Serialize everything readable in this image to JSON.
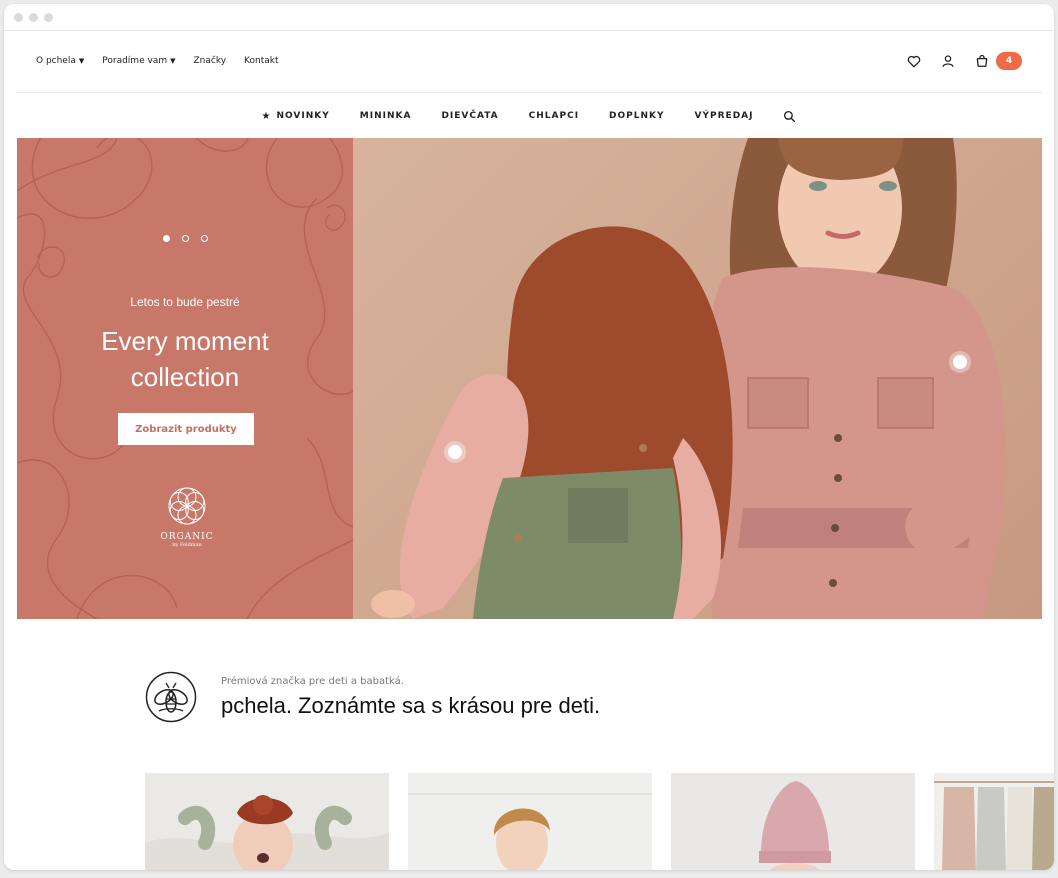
{
  "topnav": {
    "links": [
      {
        "label": "O pchela",
        "dropdown": true
      },
      {
        "label": "Poradíme vam",
        "dropdown": true
      },
      {
        "label": "Značky",
        "dropdown": false
      },
      {
        "label": "Kontakt",
        "dropdown": false
      }
    ],
    "icons": [
      "heart-icon",
      "user-icon",
      "bag-icon"
    ],
    "cart_count": "4"
  },
  "mainnav": {
    "items": [
      "NOVINKY",
      "MININKA",
      "DIEVČATA",
      "CHLAPCI",
      "DOPLNKY",
      "VÝPREDAJ"
    ],
    "first_item_icon": "star-icon",
    "search_icon": "search-icon"
  },
  "hero": {
    "subtitle": "Letos to bude pestré",
    "title_line1": "Every moment",
    "title_line2": "collection",
    "button_label": "Zobrazit produkty",
    "slider_active_index": 0,
    "slider_count": 3,
    "logo_text": "ORGANIC",
    "logo_subtext": "by Feldman",
    "left_bg": "#c87869"
  },
  "intro": {
    "small": "Prémiová značka pre deti a babatká.",
    "title": "pchela. Zoznámte sa s krásou pre deti."
  },
  "colors": {
    "accent": "#f06a48",
    "brand_rose": "#c87869"
  }
}
